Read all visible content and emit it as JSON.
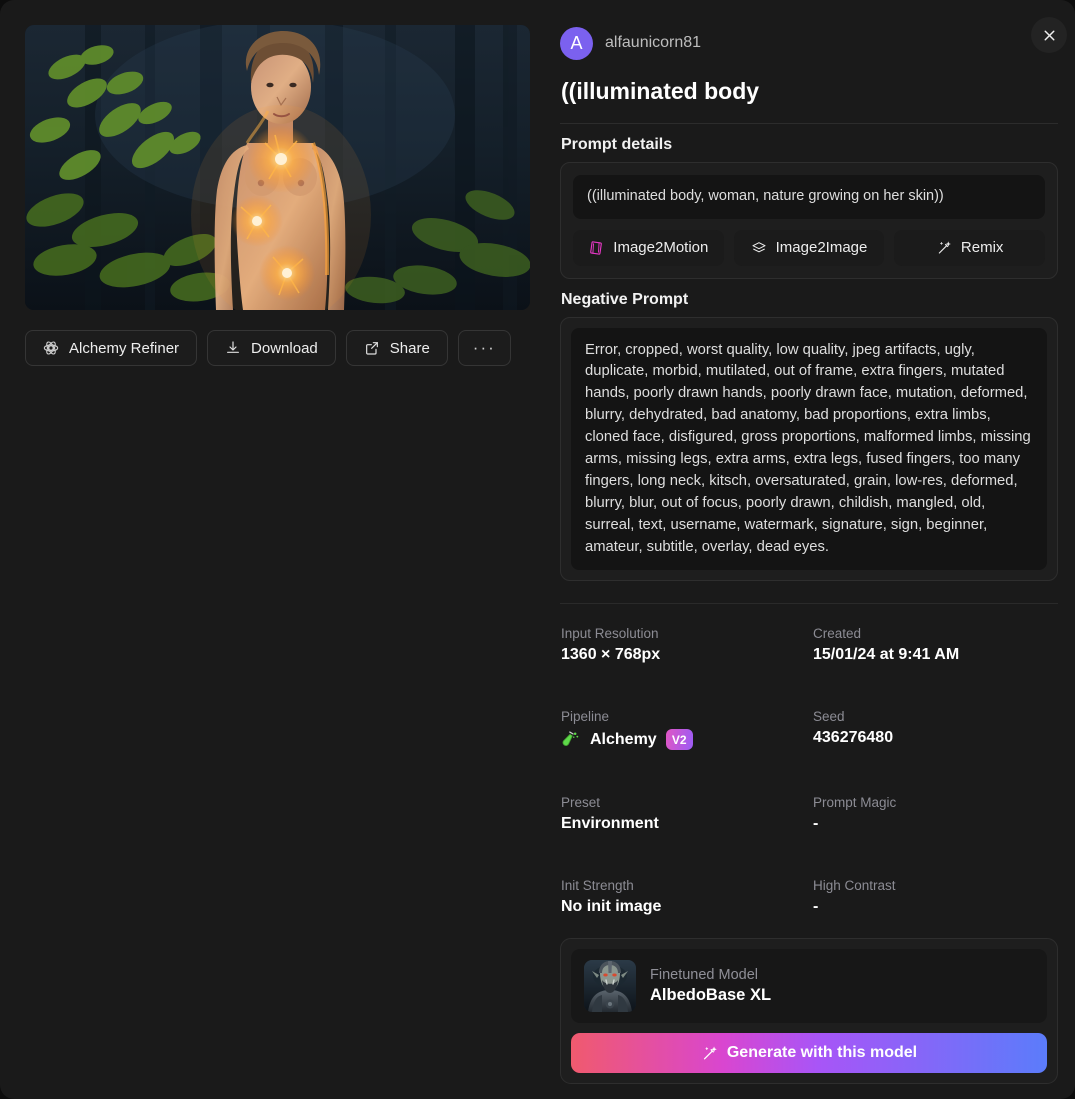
{
  "modal": {
    "close_icon": "close-icon"
  },
  "user": {
    "avatar_initial": "A",
    "name": "alfaunicorn81",
    "avatar_color": "#7b61ef"
  },
  "title": "((illuminated body",
  "sections": {
    "prompt_details_label": "Prompt details",
    "negative_prompt_label": "Negative Prompt"
  },
  "prompt": {
    "text": "((illuminated body, woman, nature growing on her skin))"
  },
  "chips": [
    {
      "label": "Image2Motion",
      "icon": "film-strip-icon",
      "icon_color": "#e838c6"
    },
    {
      "label": "Image2Image",
      "icon": "layers-icon",
      "icon_color": "#ededed"
    },
    {
      "label": "Remix",
      "icon": "magic-wand-icon",
      "icon_color": "#ededed"
    }
  ],
  "negative_prompt": {
    "text": "Error, cropped, worst quality, low quality, jpeg artifacts, ugly, duplicate, morbid, mutilated, out of frame, extra fingers, mutated hands, poorly drawn hands, poorly drawn face, mutation, deformed, blurry, dehydrated, bad anatomy, bad proportions, extra limbs, cloned face, disfigured, gross proportions, malformed limbs, missing arms, missing legs, extra arms, extra legs, fused fingers, too many fingers, long neck, kitsch, oversaturated, grain, low-res, deformed, blurry, blur, out of focus, poorly drawn, childish, mangled, old, surreal, text, username, watermark, signature, sign, beginner, amateur, subtitle, overlay, dead eyes."
  },
  "actions": [
    {
      "label": "Alchemy Refiner",
      "icon": "alchemy-refiner-icon"
    },
    {
      "label": "Download",
      "icon": "download-icon"
    },
    {
      "label": "Share",
      "icon": "share-icon"
    },
    {
      "label": "···",
      "icon": "more-icon"
    }
  ],
  "metadata": [
    {
      "key": "Input Resolution",
      "value": "1360 × 768px"
    },
    {
      "key": "Created",
      "value": "15/01/24 at 9:41 AM"
    },
    {
      "key": "Pipeline",
      "value": "Alchemy",
      "badge": "V2",
      "icon": "alchemy-flask-icon"
    },
    {
      "key": "Seed",
      "value": "436276480"
    },
    {
      "key": "Preset",
      "value": "Environment"
    },
    {
      "key": "Prompt Magic",
      "value": "-"
    },
    {
      "key": "Init Strength",
      "value": "No init image"
    },
    {
      "key": "High Contrast",
      "value": "-"
    }
  ],
  "model": {
    "label": "Finetuned Model",
    "name": "AlbedoBase XL",
    "thumbnail_icon": "orc-warrior-thumbnail"
  },
  "generate_button": {
    "label": "Generate with this model",
    "icon": "magic-wand-icon",
    "gradient_from": "#f05a6e",
    "gradient_to": "#5b7cfa"
  },
  "preview_image": {
    "alt": "illuminated-body-forest-render"
  }
}
